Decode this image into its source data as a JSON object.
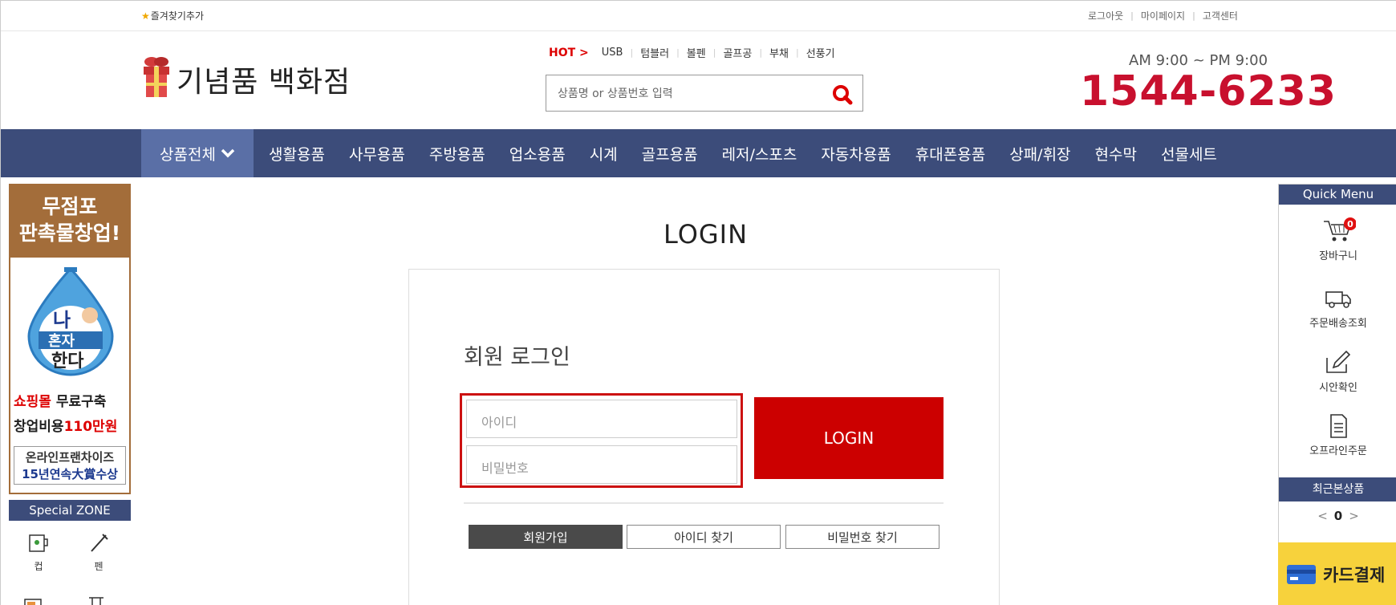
{
  "topbar": {
    "bookmark_star": "★",
    "bookmark": "즐겨찾기추가",
    "links": [
      "로그아웃",
      "마이페이지",
      "고객센터"
    ]
  },
  "header": {
    "logo_text": "기념품 백화점",
    "hot_label": "HOT >",
    "hot_keywords": [
      "USB",
      "텀블러",
      "볼펜",
      "골프공",
      "부채",
      "선풍기"
    ],
    "search_placeholder": "상품명 or 상품번호 입력",
    "hours": "AM 9:00 ~ PM 9:00",
    "phone": "1544-6233"
  },
  "nav": {
    "all_label": "상품전체",
    "items": [
      "생활용품",
      "사무용품",
      "주방용품",
      "업소용품",
      "시계",
      "골프용품",
      "레저/스포츠",
      "자동차용품",
      "휴대폰용품",
      "상패/휘장",
      "현수막",
      "선물세트"
    ]
  },
  "left_banner": {
    "line1": "무점포",
    "line2": "판촉물창업!",
    "drop_l1": "나",
    "drop_l2": "혼자",
    "drop_l3": "한다",
    "shop_red": "쇼핑몰",
    "shop_rest": " 무료구축",
    "cost_prefix": "창업비용",
    "cost_red": "110만원",
    "award_l1": "온라인프랜차이즈",
    "award_l2": "15년연속大賞수상"
  },
  "special": {
    "title": "Special ZONE",
    "items": [
      "컵",
      "펜"
    ]
  },
  "login": {
    "title": "LOGIN",
    "member_title": "회원 로그인",
    "id_placeholder": "아이디",
    "pw_placeholder": "비밀번호",
    "login_button": "LOGIN",
    "signup": "회원가입",
    "find_id": "아이디 찾기",
    "find_pw": "비밀번호 찾기"
  },
  "quick_menu": {
    "title": "Quick Menu",
    "cart_count": "0",
    "items": [
      "장바구니",
      "주문배송조회",
      "시안확인",
      "오프라인주문"
    ],
    "recent_title": "최근본상품",
    "recent_prev": "<",
    "recent_count": "0",
    "recent_next": ">",
    "card_pay": "카드결제"
  },
  "colors": {
    "nav_bg": "#3c4c7a",
    "nav_active": "#5a6fa6",
    "accent_red": "#cc0000",
    "phone_red": "#c8102e",
    "banner_brown": "#a36d3a",
    "card_yellow": "#f7d23c"
  }
}
